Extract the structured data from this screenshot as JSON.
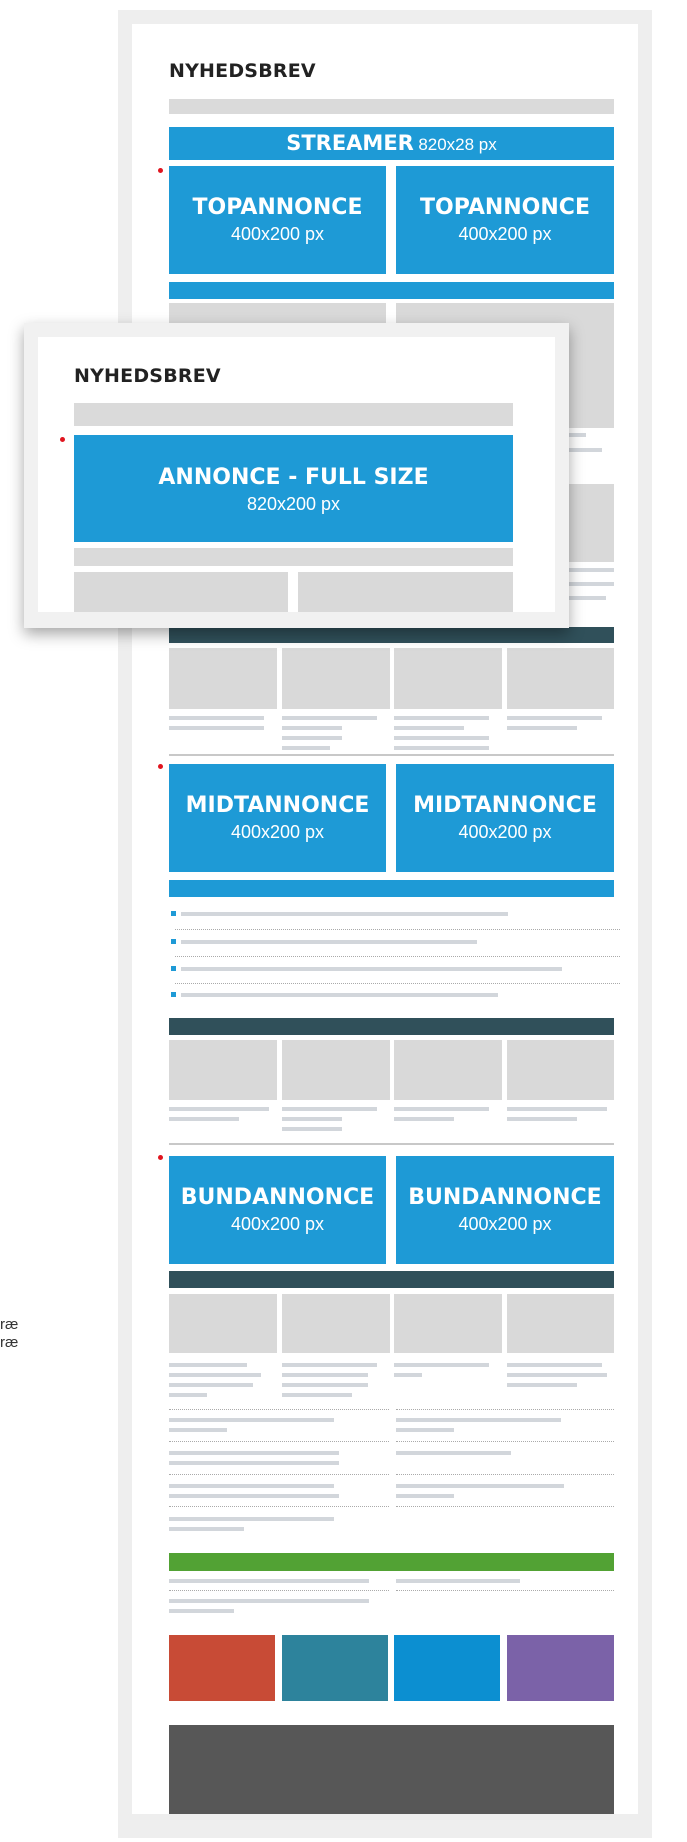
{
  "newsletter": {
    "title": "NYHEDSBREV",
    "streamer": {
      "label": "STREAMER",
      "size": "820x28 px"
    },
    "top_ads": [
      {
        "label": "TOPANNONCE",
        "size": "400x200 px"
      },
      {
        "label": "TOPANNONCE",
        "size": "400x200 px"
      }
    ],
    "mid_ads": [
      {
        "label": "MIDTANNONCE",
        "size": "400x200 px"
      },
      {
        "label": "MIDTANNONCE",
        "size": "400x200 px"
      }
    ],
    "bottom_ads": [
      {
        "label": "BUNDANNONCE",
        "size": "400x200 px"
      },
      {
        "label": "BUNDANNONCE",
        "size": "400x200 px"
      }
    ]
  },
  "overlay": {
    "title": "NYHEDSBREV",
    "ad": {
      "label": "ANNONCE - FULL SIZE",
      "size": "820x200 px"
    }
  },
  "side_text": [
    "ræ",
    "ræ"
  ],
  "colors": {
    "ad_blue": "#1e9ad6",
    "dark_band": "#30505a",
    "green_band": "#52a234",
    "footer_tiles": [
      "#c84b36",
      "#2d839c",
      "#0c8fd1",
      "#7b62a8"
    ],
    "footer": "#575757"
  }
}
